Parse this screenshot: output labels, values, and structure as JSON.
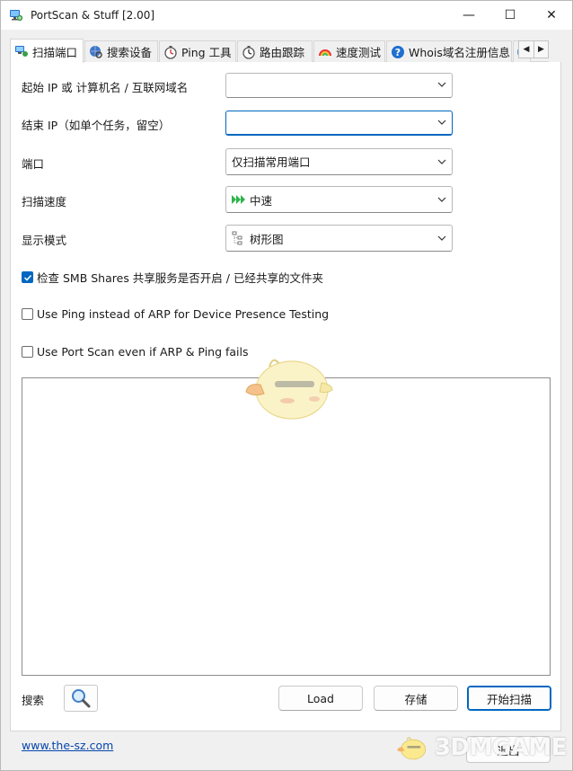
{
  "window": {
    "title": "PortScan & Stuff [2.00]",
    "controls": {
      "minimize": "—",
      "maximize": "☐",
      "close": "✕"
    }
  },
  "tabs": [
    {
      "label": "扫描端口",
      "icon": "network-computer-icon",
      "active": true
    },
    {
      "label": "搜索设备",
      "icon": "globe-search-icon",
      "active": false
    },
    {
      "label": "Ping 工具",
      "icon": "ping-stopwatch-icon",
      "active": false
    },
    {
      "label": "路由跟踪",
      "icon": "route-stopwatch-icon",
      "active": false
    },
    {
      "label": "速度测试",
      "icon": "speed-rainbow-icon",
      "active": false
    },
    {
      "label": "Whois域名注册信息",
      "icon": "help-question-icon",
      "active": false
    }
  ],
  "form": {
    "start_ip_label": "起始 IP 或 计算机名 / 互联网域名",
    "start_ip_value": "",
    "end_ip_label": "结束 IP（如单个任务，留空）",
    "end_ip_value": "",
    "port_label": "端口",
    "port_value": "仅扫描常用端口",
    "speed_label": "扫描速度",
    "speed_value": "中速",
    "display_label": "显示模式",
    "display_value": "树形图"
  },
  "options": {
    "smb": {
      "label": "检查 SMB Shares 共享服务是否开启 / 已经共享的文件夹",
      "checked": true
    },
    "ping": {
      "label": "Use Ping instead of ARP for Device Presence Testing",
      "checked": false
    },
    "portscan": {
      "label": "Use Port Scan even if ARP & Ping fails",
      "checked": false
    }
  },
  "bottom": {
    "search_label": "搜索",
    "load_label": "Load",
    "save_label": "存储",
    "start_label": "开始扫描"
  },
  "footer": {
    "link": "www.the-sz.com",
    "exit_label": "退出"
  },
  "watermark": {
    "text": "3DMGAME"
  },
  "colors": {
    "accent": "#0067c0",
    "link": "#0645ad",
    "speed_icon": "#2db34a"
  }
}
